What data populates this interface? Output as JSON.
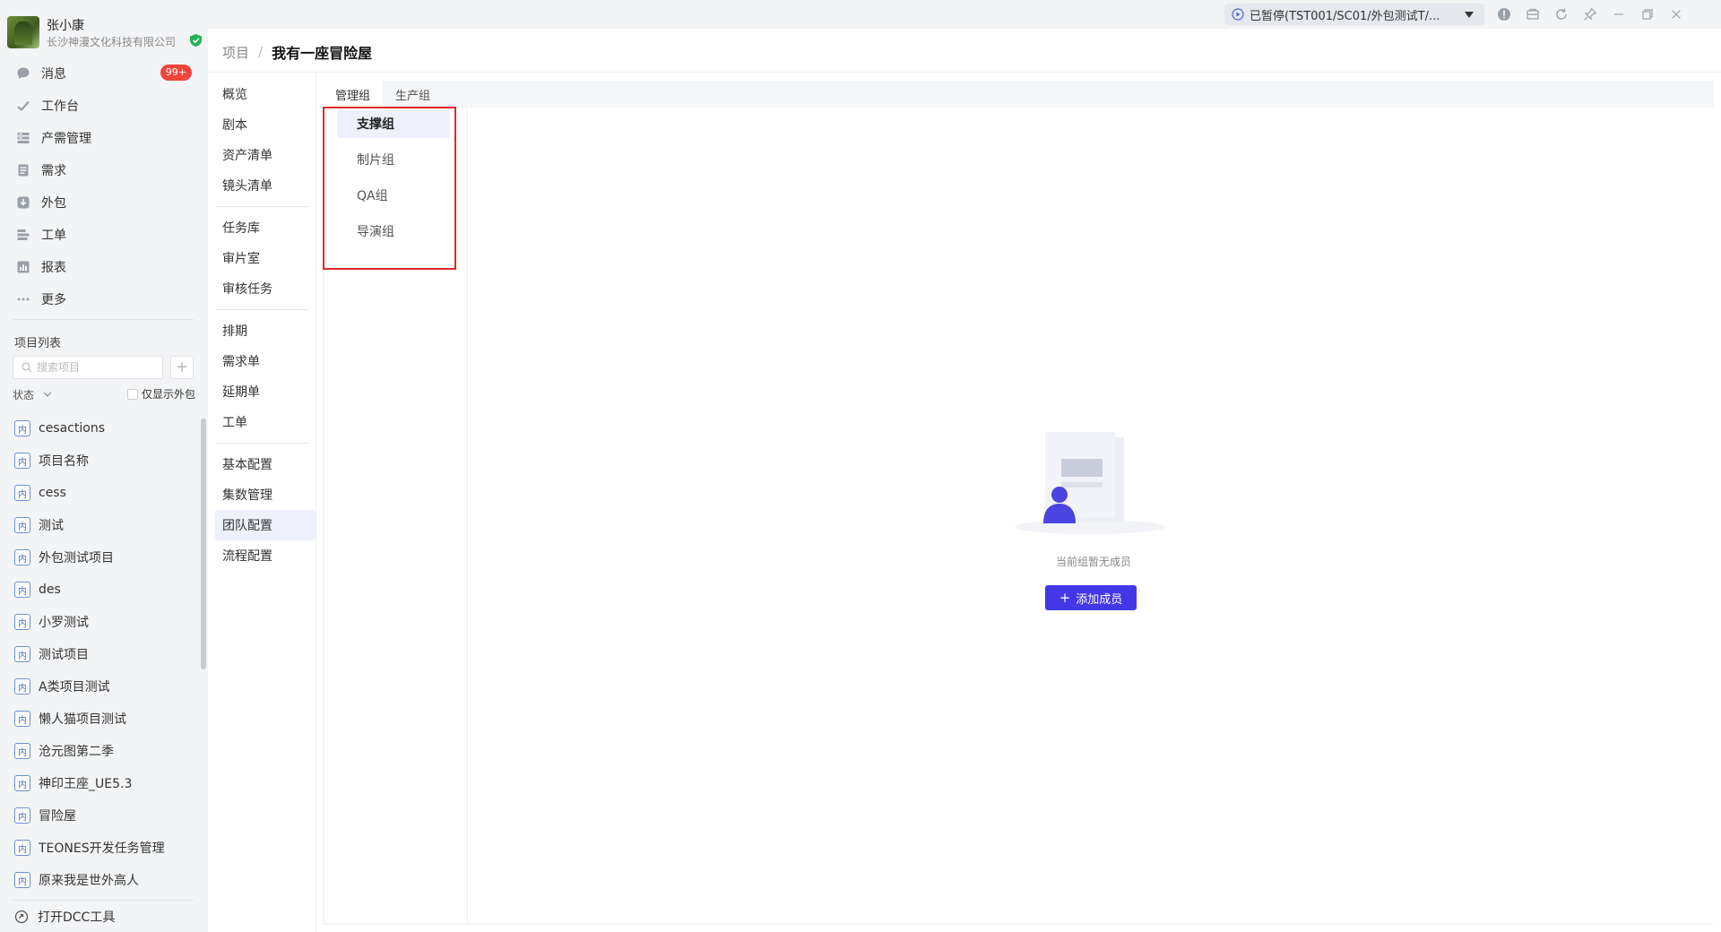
{
  "user": {
    "name": "张小康",
    "company": "长沙神漫文化科技有限公司"
  },
  "nav": [
    {
      "label": "消息",
      "icon": "message-icon",
      "badge": "99+"
    },
    {
      "label": "工作台",
      "icon": "check-icon"
    },
    {
      "label": "产需管理",
      "icon": "production-icon"
    },
    {
      "label": "需求",
      "icon": "requirement-icon"
    },
    {
      "label": "外包",
      "icon": "outsource-icon"
    },
    {
      "label": "工单",
      "icon": "workorder-icon"
    },
    {
      "label": "报表",
      "icon": "report-icon"
    },
    {
      "label": "更多",
      "icon": "more-icon"
    }
  ],
  "projects": {
    "title": "项目列表",
    "search_placeholder": "搜索项目",
    "add_label": "+",
    "status_label": "状态",
    "only_outsource_label": "仅显示外包",
    "tag": "内",
    "items": [
      "cesactions",
      "项目名称",
      "cess",
      "测试",
      "外包测试项目",
      "des",
      "小罗测试",
      "测试项目",
      "A类项目测试",
      "懒人猫项目测试",
      "沧元图第二季",
      "神印王座_UE5.3",
      "冒险屋",
      "TEONES开发任务管理",
      "原来我是世外高人"
    ]
  },
  "dcc_label": "打开DCC工具",
  "titlebar": {
    "task_status": "已暂停(TST001/SC01/外包测试T/..."
  },
  "breadcrumb": {
    "root": "项目",
    "sep": "/",
    "current": "我有一座冒险屋"
  },
  "subnav": {
    "group1": [
      "概览",
      "剧本",
      "资产清单",
      "镜头清单"
    ],
    "group2": [
      "任务库",
      "审片室",
      "审核任务"
    ],
    "group3": [
      "排期",
      "需求单",
      "延期单",
      "工单"
    ],
    "group4": [
      "基本配置",
      "集数管理",
      "团队配置",
      "流程配置"
    ],
    "active": "团队配置"
  },
  "tabs": [
    {
      "label": "管理组",
      "active": true
    },
    {
      "label": "生产组",
      "active": false
    }
  ],
  "groups": [
    "支撑组",
    "制片组",
    "QA组",
    "导演组"
  ],
  "active_group": "支撑组",
  "empty_state": {
    "text": "当前组暂无成员",
    "button": "添加成员"
  },
  "colors": {
    "primary": "#4338e8",
    "badge": "#f2453d",
    "highlight": "#e0272a"
  }
}
